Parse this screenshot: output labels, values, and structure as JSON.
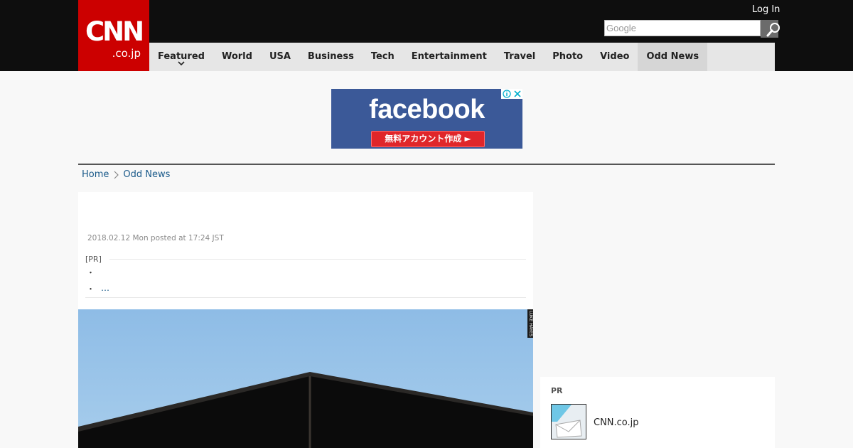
{
  "header": {
    "logo_main": "CNN",
    "logo_sub": ".co.jp",
    "login_label": "Log In",
    "search_placeholder": "Google"
  },
  "nav": {
    "items": [
      "Featured",
      "World",
      "USA",
      "Business",
      "Tech",
      "Entertainment",
      "Travel",
      "Photo",
      "Video",
      "Odd News"
    ],
    "active": "Odd News"
  },
  "ad": {
    "brand": "facebook",
    "cta": "無料アカウント作成 ►",
    "adchoice_icon": "adchoices-icon",
    "close_icon": "close-icon",
    "color": "#3b5998"
  },
  "breadcrumb": {
    "home": "Home",
    "section": "Odd News"
  },
  "article": {
    "date": "2018.02.12 Mon posted at 17:24 JST",
    "pr_label": "[PR]",
    "bullet1": "・",
    "bullet2": "・",
    "more": "…",
    "photo_credit": "LUKE HAYES"
  },
  "sidebar": {
    "pr_label": "PR",
    "item_name": "CNN.co.jp"
  },
  "colors": {
    "brand_red": "#cc0000",
    "header_bg": "#0e0e0e",
    "link": "#1a5a8a"
  }
}
